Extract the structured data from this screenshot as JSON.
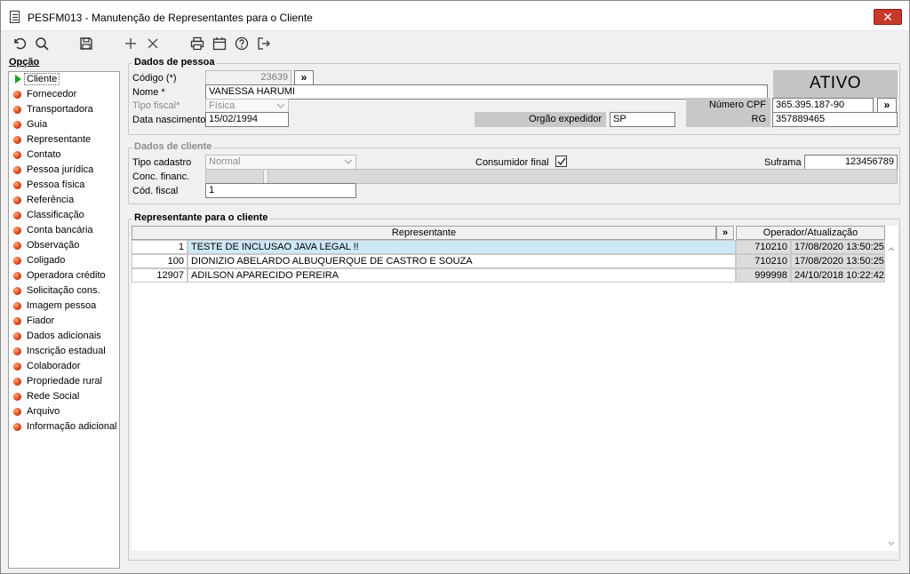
{
  "window": {
    "title": "PESFM013 - Manutenção de Representantes para o Cliente",
    "close_glyph": "✕"
  },
  "toolbar": {
    "icons": [
      "undo-icon",
      "search-icon",
      "save-icon",
      "add-icon",
      "delete-icon",
      "print-icon",
      "calendar-icon",
      "help-icon",
      "exit-icon"
    ]
  },
  "sidebar": {
    "header": "Opção",
    "items": [
      {
        "label": "Cliente",
        "active": true
      },
      {
        "label": "Fornecedor"
      },
      {
        "label": "Transportadora"
      },
      {
        "label": "Guia"
      },
      {
        "label": "Representante"
      },
      {
        "label": "Contato"
      },
      {
        "label": "Pessoa jurídica"
      },
      {
        "label": "Pessoa física"
      },
      {
        "label": "Referência"
      },
      {
        "label": "Classificação"
      },
      {
        "label": "Conta bancária"
      },
      {
        "label": "Observação"
      },
      {
        "label": "Coligado"
      },
      {
        "label": "Operadora crédito"
      },
      {
        "label": "Solicitação cons."
      },
      {
        "label": "Imagem pessoa"
      },
      {
        "label": "Fiador"
      },
      {
        "label": "Dados adicionais"
      },
      {
        "label": "Inscrição estadual"
      },
      {
        "label": "Colaborador"
      },
      {
        "label": "Propriedade rural"
      },
      {
        "label": "Rede Social"
      },
      {
        "label": "Arquivo"
      },
      {
        "label": "Informação adicional"
      }
    ]
  },
  "pessoa": {
    "legend": "Dados de pessoa",
    "codigo_label": "Código (*)",
    "codigo_value": "23639",
    "expand_glyph": "»",
    "nome_label": "Nome *",
    "nome_value": "VANESSA HARUMI",
    "tipo_fiscal_label": "Tipo fiscal*",
    "tipo_fiscal_value": "Física",
    "nascimento_label": "Data nascimento",
    "nascimento_value": "15/02/1994",
    "orgao_label": "Orgão expedidor",
    "orgao_value": "SP",
    "status": "ATIVO",
    "cpf_label": "Número CPF",
    "cpf_value": "365.395.187-90",
    "rg_label": "RG",
    "rg_value": "357889465"
  },
  "cliente": {
    "legend": "Dados de cliente",
    "tipo_cadastro_label": "Tipo cadastro",
    "tipo_cadastro_value": "Normal",
    "consumidor_label": "Consumidor final",
    "consumidor_checked": true,
    "suframa_label": "Suframa",
    "suframa_value": "123456789",
    "conc_label": "Conc. financ.",
    "cod_fiscal_label": "Cód. fiscal",
    "cod_fiscal_value": "1"
  },
  "representantes": {
    "legend": "Representante para o cliente",
    "col_representante": "Representante",
    "col_expand": "»",
    "col_operador": "Operador/Atualização",
    "rows": [
      {
        "codigo": "1",
        "nome": "TESTE DE INCLUSAO JAVA LEGAL !!",
        "operador": "710210",
        "data": "17/08/2020 13:50:25",
        "selected": true
      },
      {
        "codigo": "100",
        "nome": "DIONIZIO ABELARDO ALBUQUERQUE DE CASTRO E SOUZA",
        "operador": "710210",
        "data": "17/08/2020 13:50:25"
      },
      {
        "codigo": "12907",
        "nome": "ADILSON APARECIDO PEREIRA",
        "operador": "999998",
        "data": "24/10/2018 10:22:42"
      }
    ]
  }
}
